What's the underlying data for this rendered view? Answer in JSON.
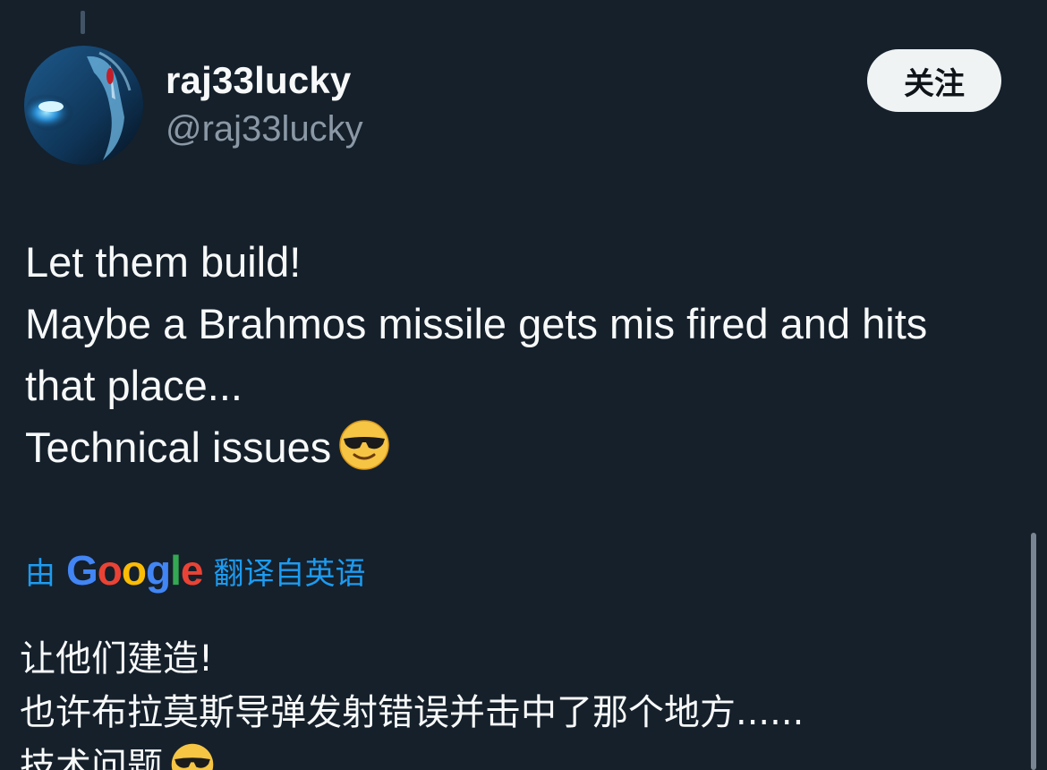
{
  "author": {
    "display_name": "raj33lucky",
    "handle": "@raj33lucky",
    "avatar_icon": "avatar-image"
  },
  "actions": {
    "follow_label": "关注"
  },
  "tweet": {
    "lines": [
      "Let them build!",
      "Maybe a Brahmos missile gets mis fired and hits",
      "that place...",
      "Technical issues"
    ],
    "emoji": "smiling-face-with-sunglasses-icon"
  },
  "translation": {
    "prefix": "由",
    "provider": "Google",
    "suffix": "翻译自英语"
  },
  "translated_tweet": {
    "lines": [
      "让他们建造!",
      "也许布拉莫斯导弹发射错误并击中了那个地方......",
      "技术问题"
    ]
  },
  "colors": {
    "background": "#15202b",
    "text_primary": "#f7f9f9",
    "text_secondary": "#8b98a5",
    "accent_link": "#1d9bf0",
    "button_bg": "#eff3f4"
  }
}
